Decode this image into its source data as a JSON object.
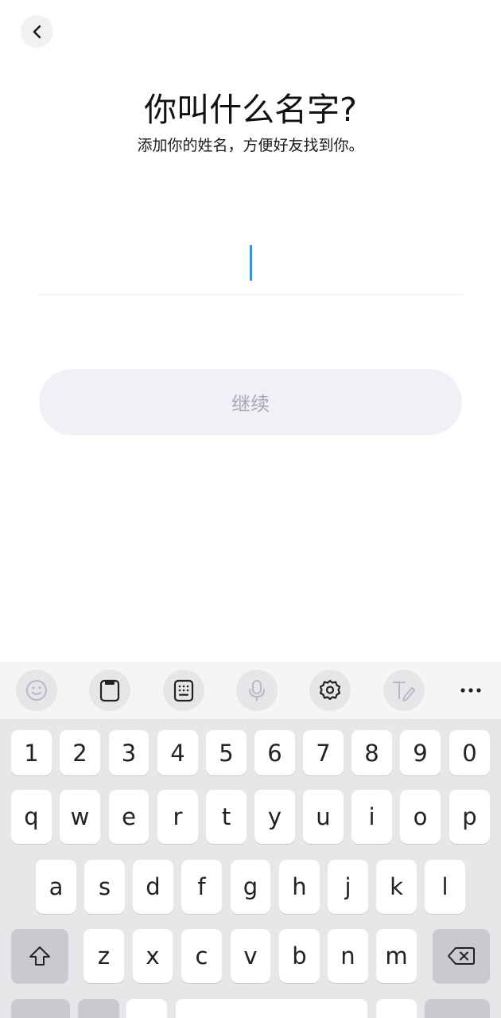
{
  "header": {
    "back_icon": "chevron-left-icon"
  },
  "page": {
    "title": "你叫什么名字?",
    "subtitle": "添加你的姓名，方便好友找到你。"
  },
  "name_input": {
    "value": "",
    "placeholder": "",
    "cursor_color": "#3a8ee6"
  },
  "continue_button": {
    "label": "继续",
    "background": "#f1f0f6",
    "text_color": "#a7a8b4"
  },
  "keyboard": {
    "toolbar": {
      "icons": [
        "emoji-icon",
        "clipboard-icon",
        "keypad-icon",
        "microphone-icon",
        "gear-icon",
        "handwriting-icon",
        "more-icon"
      ]
    },
    "number_row": [
      "1",
      "2",
      "3",
      "4",
      "5",
      "6",
      "7",
      "8",
      "9",
      "0"
    ],
    "row1": [
      "q",
      "w",
      "e",
      "r",
      "t",
      "y",
      "u",
      "i",
      "o",
      "p"
    ],
    "row2": [
      "a",
      "s",
      "d",
      "f",
      "g",
      "h",
      "j",
      "k",
      "l"
    ],
    "row3": [
      "z",
      "x",
      "c",
      "v",
      "b",
      "n",
      "m"
    ],
    "shift_icon": "shift-icon",
    "backspace_icon": "backspace-icon"
  }
}
